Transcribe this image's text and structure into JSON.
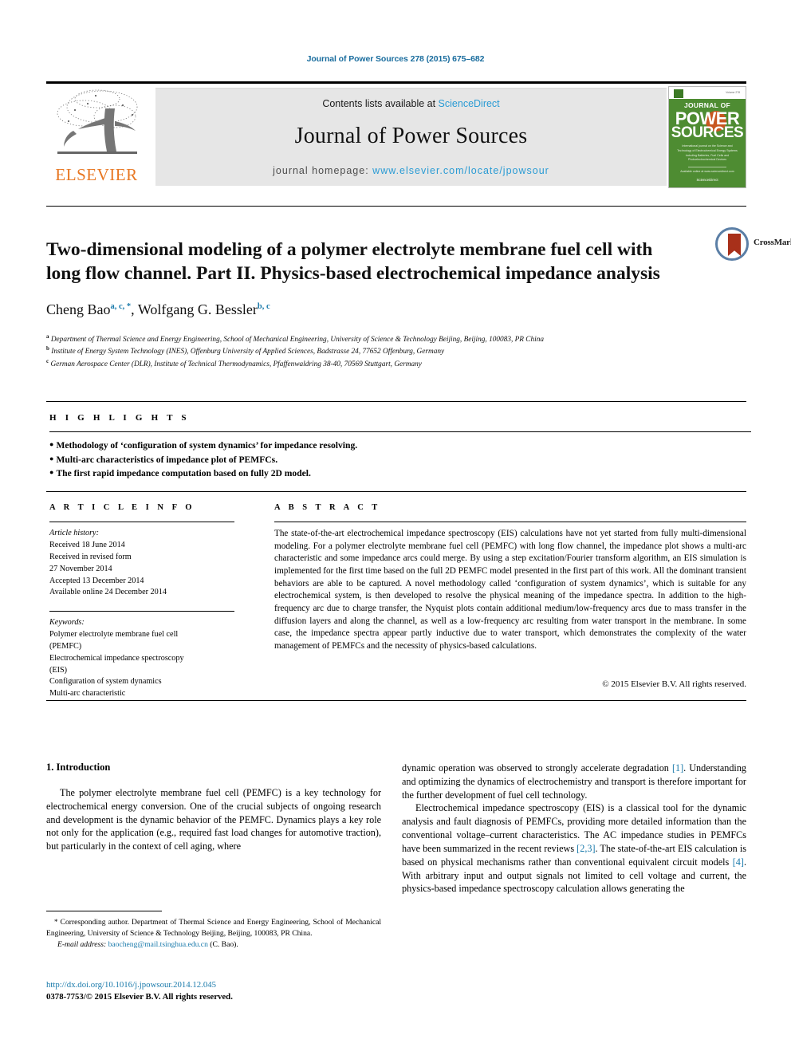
{
  "running_head": "Journal of Power Sources 278 (2015) 675–682",
  "masthead": {
    "contents_prefix": "Contents lists available at ",
    "contents_link": "ScienceDirect",
    "journal_name": "Journal of Power Sources",
    "homepage_prefix": "journal homepage: ",
    "homepage_url": "www.elsevier.com/locate/jpowsour",
    "publisher_logo_text": "ELSEVIER",
    "cover": {
      "line1": "JOURNAL OF",
      "line2": "POWER",
      "line3": "SOURCES",
      "blurb": "International journal on the Science and Technology of Electrochemical Energy Systems including Batteries, Fuel Cells and Photoelectrochemical Devices",
      "footer": "Available online at www.sciencedirect.com",
      "footer2": "ScienceDirect"
    }
  },
  "crossmark": {
    "label": "CrossMark"
  },
  "title": "Two-dimensional modeling of a polymer electrolyte membrane fuel cell with long flow channel. Part II. Physics-based electrochemical impedance analysis",
  "authors": [
    {
      "name": "Cheng Bao",
      "marks": "a, c, *"
    },
    {
      "name": "Wolfgang G. Bessler",
      "marks": "b, c"
    }
  ],
  "affiliations": [
    {
      "mark": "a",
      "text": "Department of Thermal Science and Energy Engineering, School of Mechanical Engineering, University of Science & Technology Beijing, Beijing, 100083, PR China"
    },
    {
      "mark": "b",
      "text": "Institute of Energy System Technology (INES), Offenburg University of Applied Sciences, Badstrasse 24, 77652 Offenburg, Germany"
    },
    {
      "mark": "c",
      "text": "German Aerospace Center (DLR), Institute of Technical Thermodynamics, Pfaffenwaldring 38-40, 70569 Stuttgart, Germany"
    }
  ],
  "highlights": {
    "heading": "H I G H L I G H T S",
    "items": [
      "Methodology of ‘configuration of system dynamics’ for impedance resolving.",
      "Multi-arc characteristics of impedance plot of PEMFCs.",
      "The first rapid impedance computation based on fully 2D model."
    ]
  },
  "article_info": {
    "heading": "A R T I C L E   I N F O",
    "history_label": "Article history:",
    "history": [
      "Received 18 June 2014",
      "Received in revised form",
      "27 November 2014",
      "Accepted 13 December 2014",
      "Available online 24 December 2014"
    ],
    "keywords_label": "Keywords:",
    "keywords": [
      "Polymer electrolyte membrane fuel cell",
      "(PEMFC)",
      "Electrochemical impedance spectroscopy",
      "(EIS)",
      "Configuration of system dynamics",
      "Multi-arc characteristic"
    ]
  },
  "abstract": {
    "heading": "A B S T R A C T",
    "text": "The state-of-the-art electrochemical impedance spectroscopy (EIS) calculations have not yet started from fully multi-dimensional modeling. For a polymer electrolyte membrane fuel cell (PEMFC) with long flow channel, the impedance plot shows a multi-arc characteristic and some impedance arcs could merge. By using a step excitation/Fourier transform algorithm, an EIS simulation is implemented for the first time based on the full 2D PEMFC model presented in the first part of this work. All the dominant transient behaviors are able to be captured. A novel methodology called ‘configuration of system dynamics’, which is suitable for any electrochemical system, is then developed to resolve the physical meaning of the impedance spectra. In addition to the high-frequency arc due to charge transfer, the Nyquist plots contain additional medium/low-frequency arcs due to mass transfer in the diffusion layers and along the channel, as well as a low-frequency arc resulting from water transport in the membrane. In some case, the impedance spectra appear partly inductive due to water transport, which demonstrates the complexity of the water management of PEMFCs and the necessity of physics-based calculations.",
    "copyright": "© 2015 Elsevier B.V. All rights reserved."
  },
  "body": {
    "section_number_title": "1.  Introduction",
    "left_paragraphs": [
      "The polymer electrolyte membrane fuel cell (PEMFC) is a key technology for electrochemical energy conversion. One of the crucial subjects of ongoing research and development is the dynamic behavior of the PEMFC. Dynamics plays a key role not only for the application (e.g., required fast load changes for automotive traction), but particularly in the context of cell aging, where"
    ],
    "right_paragraph_1_pre": "dynamic operation was observed to strongly accelerate degradation ",
    "right_paragraph_1_ref": "[1]",
    "right_paragraph_1_post": ". Understanding and optimizing the dynamics of electrochemistry and transport is therefore important for the further development of fuel cell technology.",
    "right_paragraph_2_a": "Electrochemical impedance spectroscopy (EIS) is a classical tool for the dynamic analysis and fault diagnosis of PEMFCs, providing more detailed information than the conventional voltage–current characteristics. The AC impedance studies in PEMFCs have been summarized in the recent reviews ",
    "right_paragraph_2_ref1": "[2,3]",
    "right_paragraph_2_b": ". The state-of-the-art EIS calculation is based on physical mechanisms rather than conventional equivalent circuit models ",
    "right_paragraph_2_ref2": "[4]",
    "right_paragraph_2_c": ". With arbitrary input and output signals not limited to cell voltage and current, the physics-based impedance spectroscopy calculation allows generating the"
  },
  "footnote": {
    "star": "*",
    "corresponding": " Corresponding author. Department of Thermal Science and Energy Engineering, School of Mechanical Engineering, University of Science & Technology Beijing, Beijing, 100083, PR China.",
    "email_label": "E-mail address:",
    "email": "baocheng@mail.tsinghua.edu.cn",
    "email_suffix": "(C. Bao)."
  },
  "doi_block": {
    "doi_url": "http://dx.doi.org/10.1016/j.jpowsour.2014.12.045",
    "issn_line": "0378-7753/© 2015 Elsevier B.V. All rights reserved."
  },
  "colors": {
    "link_blue": "#1a7aab",
    "science_direct_blue": "#2a9bd4",
    "elsevier_orange": "#E87722",
    "cover_green": "#4e8c32",
    "band_gray": "#e6e6e6"
  }
}
